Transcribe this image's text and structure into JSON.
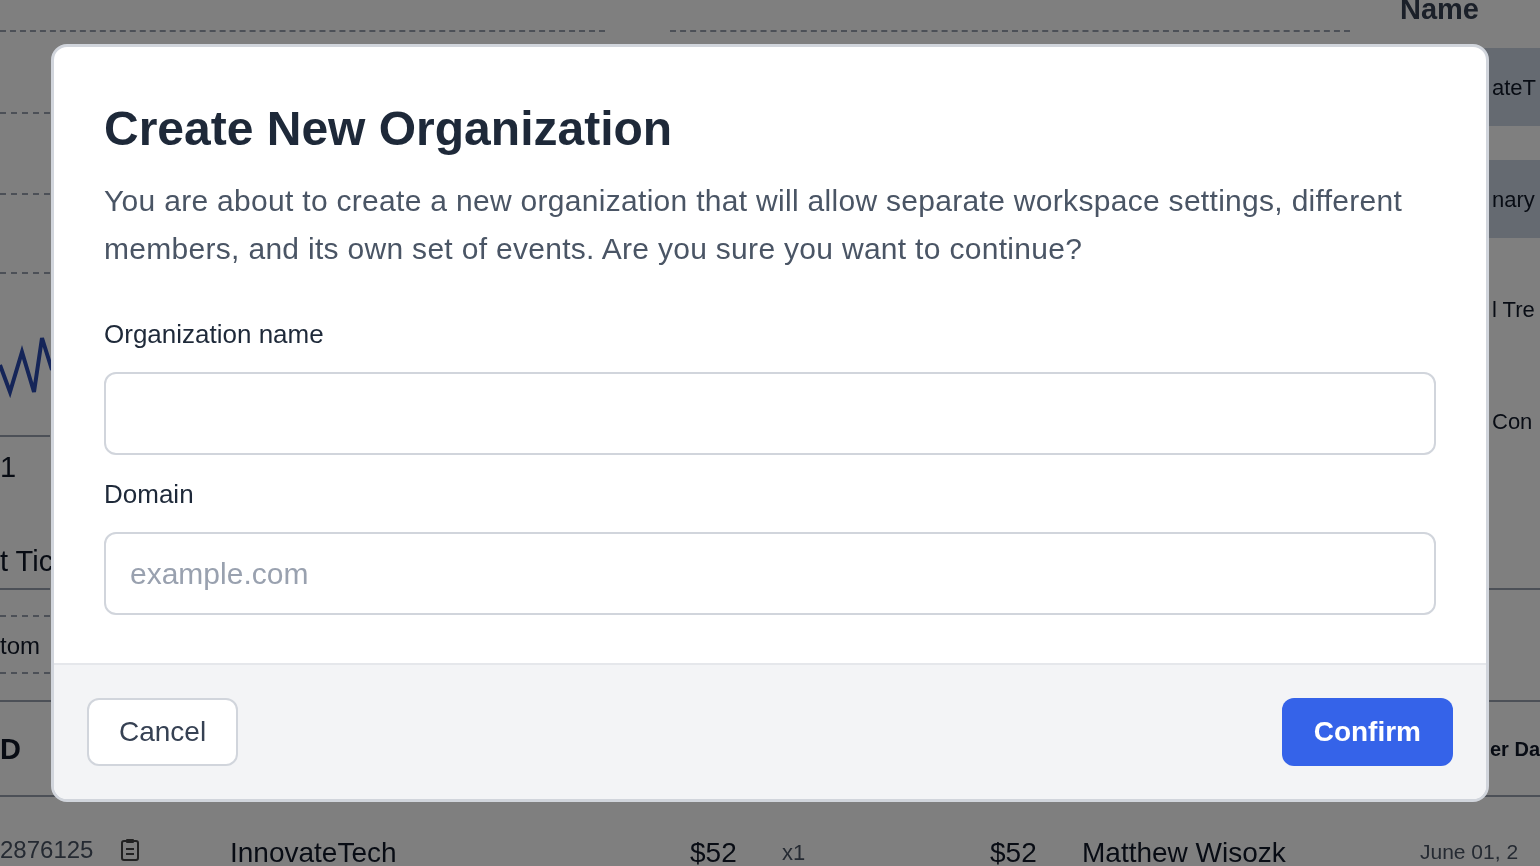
{
  "background": {
    "left_texts": [
      {
        "text": "1",
        "bold": false
      },
      {
        "text": "t Tic",
        "bold": false
      },
      {
        "text": "tom",
        "bold": false
      },
      {
        "text": "D",
        "bold": true
      }
    ],
    "right_header": "Name",
    "right_rows": [
      {
        "text": "ateT",
        "selected": true
      },
      {
        "text": "nary",
        "selected": true
      },
      {
        "text": "l Tre",
        "selected": false
      },
      {
        "text": "Con",
        "selected": false
      }
    ],
    "right_footer": "er Da",
    "table_row": {
      "id": "2876125",
      "company": "InnovateTech",
      "price": "$52",
      "quantity": "x1",
      "total": "$52",
      "customer": "Matthew Wisozk",
      "date": "June 01, 2"
    }
  },
  "dialog": {
    "title": "Create New Organization",
    "description": "You are about to create a new organization that will allow separate workspace settings, different members, and its own set of events. Are you sure you want to continue?",
    "fields": [
      {
        "label": "Organization name"
      },
      {
        "label": "Domain",
        "placeholder": "example.com"
      }
    ],
    "buttons": [
      {
        "label": "Cancel",
        "kind": "secondary"
      },
      {
        "label": "Confirm",
        "kind": "primary"
      }
    ]
  }
}
